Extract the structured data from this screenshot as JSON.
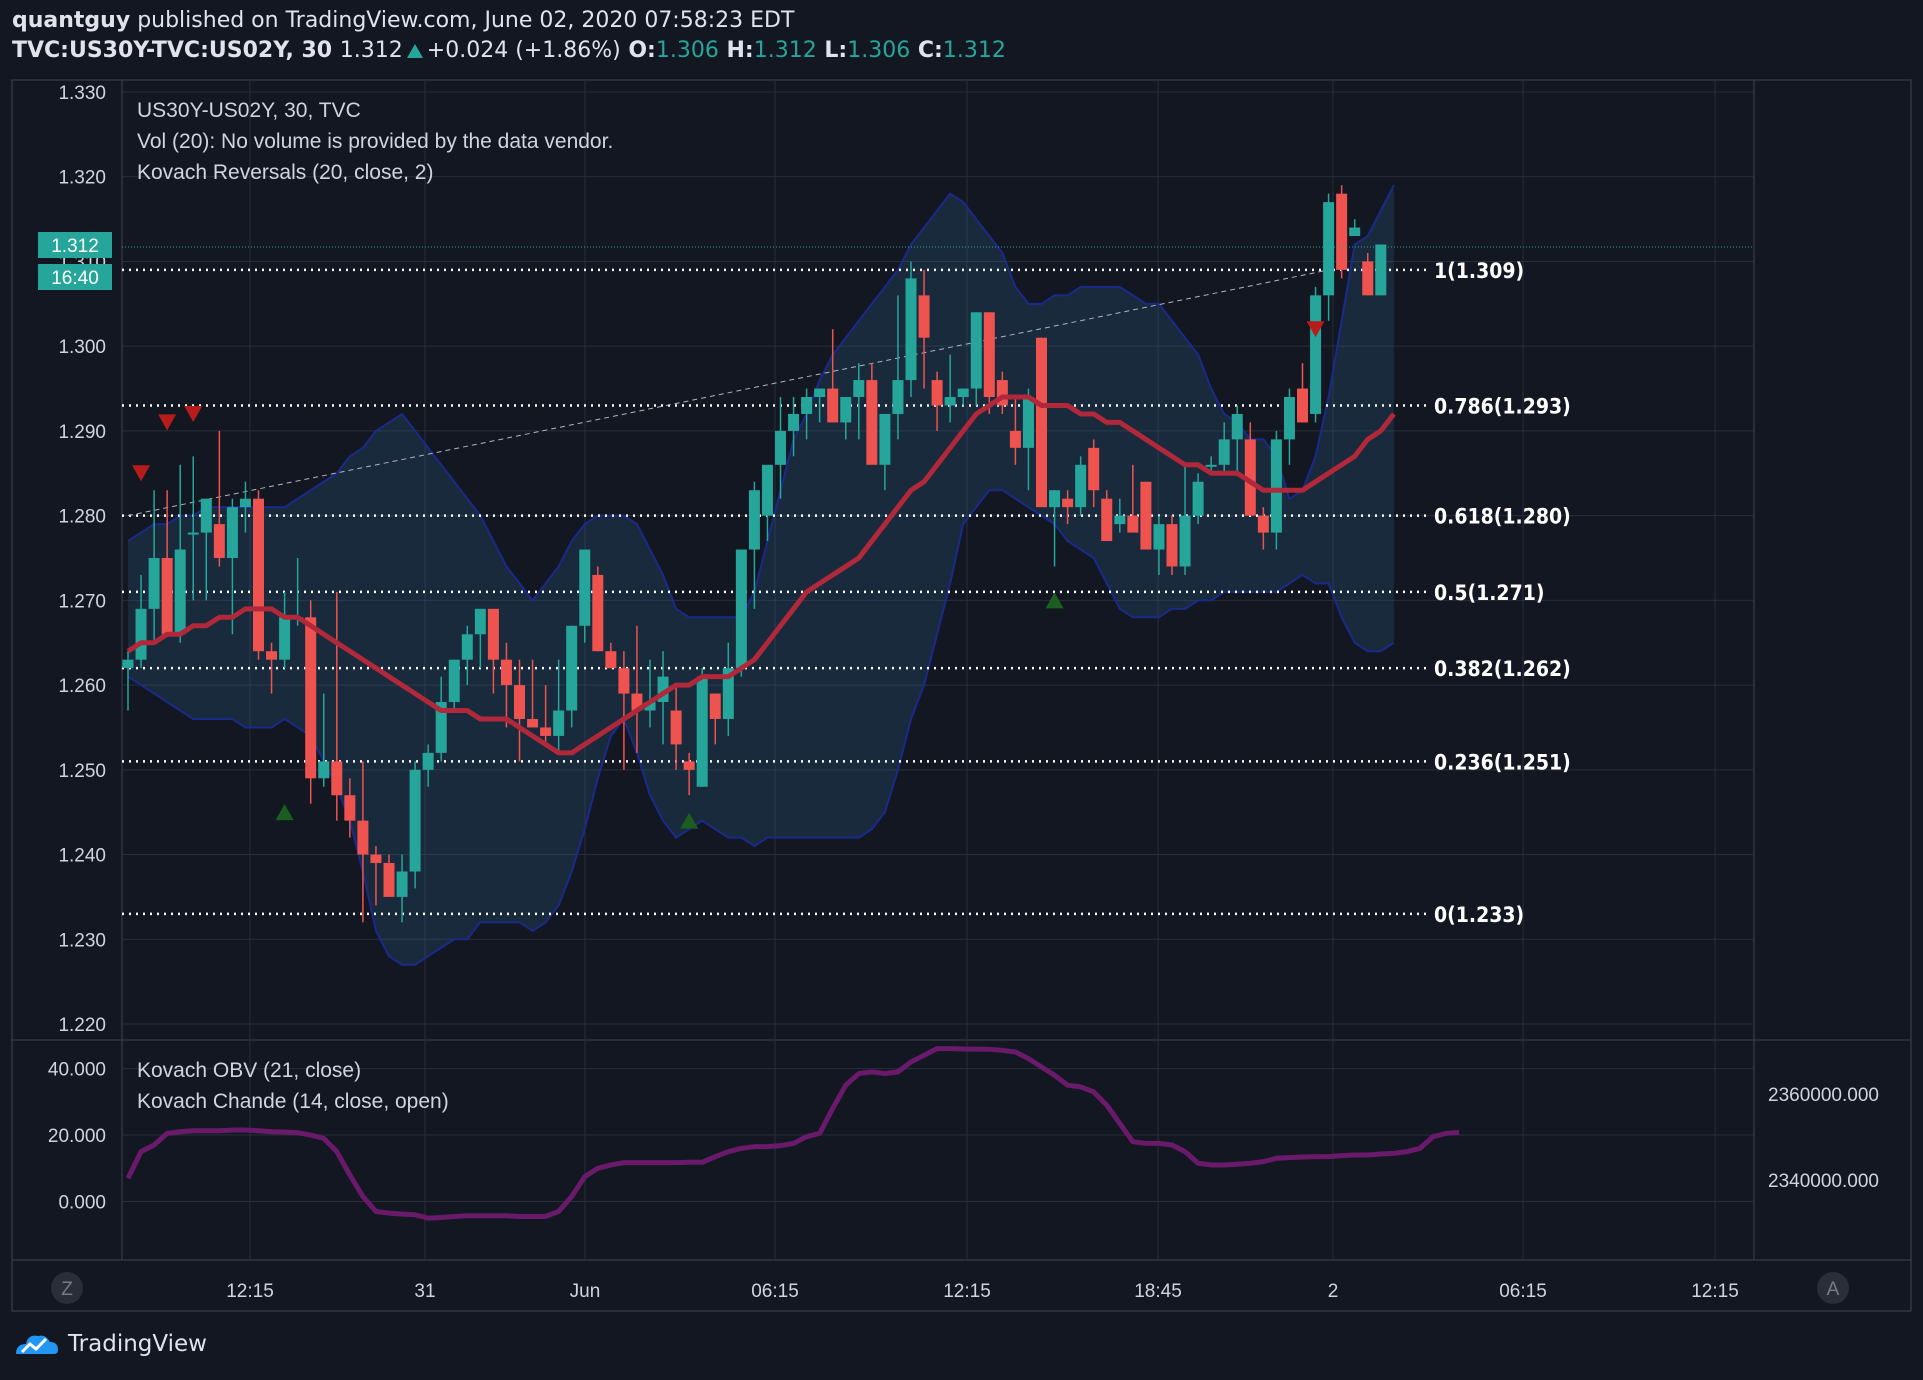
{
  "header": {
    "author": "quantguy",
    "published_text": "published on TradingView.com, June 02, 2020 07:58:23 EDT",
    "symbol": "TVC:US30Y-TVC:US02Y, 30",
    "last": "1.312",
    "change": "+0.024 (+1.86%)",
    "o_label": "O:",
    "o": "1.306",
    "h_label": "H:",
    "h": "1.312",
    "l_label": "L:",
    "l": "1.306",
    "c_label": "C:",
    "c": "1.312"
  },
  "legend": {
    "line1": "US30Y-US02Y, 30, TVC",
    "line2": "Vol (20): No volume is provided by the data vendor.",
    "line3": "Kovach Reversals (20, close, 2)",
    "lower1": "Kovach OBV (21, close)",
    "lower2": "Kovach Chande (14, close, open)"
  },
  "price_tag": {
    "price": "1.312",
    "countdown": "16:40"
  },
  "buttons": {
    "z": "Z",
    "a": "A"
  },
  "footer": {
    "brand": "TradingView"
  },
  "colors": {
    "bg": "#131722",
    "up": "#26a69a",
    "down": "#ef5350",
    "ma": "#b0283a",
    "band": "#1a2a8a",
    "obv": "#6a1a6a"
  },
  "chart_data": [
    {
      "type": "candlestick",
      "title": "US30Y-US02Y, 30, TVC",
      "ylim": [
        1.22,
        1.33
      ],
      "y_ticks": [
        "1.330",
        "1.320",
        "1.310",
        "1.300",
        "1.290",
        "1.280",
        "1.270",
        "1.260",
        "1.250",
        "1.240",
        "1.230",
        "1.220"
      ],
      "x_ticks": [
        "12:15",
        "31",
        "Jun",
        "06:15",
        "12:15",
        "18:45",
        "2",
        "06:15",
        "12:15"
      ],
      "candles": [
        [
          1.262,
          1.264,
          1.257,
          1.263
        ],
        [
          1.263,
          1.273,
          1.262,
          1.269
        ],
        [
          1.269,
          1.283,
          1.265,
          1.275
        ],
        [
          1.275,
          1.283,
          1.266,
          1.266
        ],
        [
          1.266,
          1.286,
          1.265,
          1.276
        ],
        [
          1.278,
          1.287,
          1.27,
          1.278
        ],
        [
          1.278,
          1.282,
          1.27,
          1.282
        ],
        [
          1.279,
          1.29,
          1.274,
          1.275
        ],
        [
          1.275,
          1.282,
          1.266,
          1.281
        ],
        [
          1.281,
          1.284,
          1.278,
          1.282
        ],
        [
          1.282,
          1.283,
          1.263,
          1.264
        ],
        [
          1.264,
          1.265,
          1.259,
          1.263
        ],
        [
          1.263,
          1.271,
          1.262,
          1.268
        ],
        [
          1.268,
          1.275,
          1.267,
          1.268
        ],
        [
          1.268,
          1.27,
          1.246,
          1.249
        ],
        [
          1.249,
          1.259,
          1.248,
          1.251
        ],
        [
          1.251,
          1.271,
          1.244,
          1.247
        ],
        [
          1.247,
          1.249,
          1.242,
          1.244
        ],
        [
          1.244,
          1.251,
          1.232,
          1.24
        ],
        [
          1.24,
          1.241,
          1.234,
          1.239
        ],
        [
          1.239,
          1.24,
          1.235,
          1.235
        ],
        [
          1.235,
          1.24,
          1.232,
          1.238
        ],
        [
          1.238,
          1.251,
          1.236,
          1.25
        ],
        [
          1.25,
          1.253,
          1.248,
          1.252
        ],
        [
          1.252,
          1.261,
          1.251,
          1.258
        ],
        [
          1.258,
          1.263,
          1.257,
          1.263
        ],
        [
          1.263,
          1.267,
          1.26,
          1.266
        ],
        [
          1.266,
          1.267,
          1.262,
          1.269
        ],
        [
          1.269,
          1.269,
          1.259,
          1.263
        ],
        [
          1.263,
          1.265,
          1.255,
          1.26
        ],
        [
          1.26,
          1.263,
          1.251,
          1.256
        ],
        [
          1.256,
          1.263,
          1.255,
          1.255
        ],
        [
          1.255,
          1.26,
          1.253,
          1.254
        ],
        [
          1.254,
          1.263,
          1.252,
          1.257
        ],
        [
          1.257,
          1.267,
          1.255,
          1.267
        ],
        [
          1.267,
          1.276,
          1.265,
          1.276
        ],
        [
          1.273,
          1.274,
          1.264,
          1.264
        ],
        [
          1.264,
          1.265,
          1.262,
          1.262
        ],
        [
          1.262,
          1.264,
          1.25,
          1.259
        ],
        [
          1.259,
          1.267,
          1.252,
          1.257
        ],
        [
          1.257,
          1.263,
          1.255,
          1.258
        ],
        [
          1.258,
          1.264,
          1.253,
          1.261
        ],
        [
          1.257,
          1.26,
          1.25,
          1.253
        ],
        [
          1.251,
          1.252,
          1.247,
          1.25
        ],
        [
          1.248,
          1.262,
          1.248,
          1.261
        ],
        [
          1.259,
          1.259,
          1.253,
          1.256
        ],
        [
          1.256,
          1.265,
          1.254,
          1.262
        ],
        [
          1.262,
          1.276,
          1.261,
          1.276
        ],
        [
          1.276,
          1.284,
          1.269,
          1.283
        ],
        [
          1.28,
          1.285,
          1.277,
          1.286
        ],
        [
          1.286,
          1.294,
          1.282,
          1.29
        ],
        [
          1.29,
          1.294,
          1.287,
          1.292
        ],
        [
          1.292,
          1.295,
          1.289,
          1.294
        ],
        [
          1.294,
          1.295,
          1.291,
          1.295
        ],
        [
          1.295,
          1.302,
          1.291,
          1.291
        ],
        [
          1.291,
          1.294,
          1.289,
          1.294
        ],
        [
          1.294,
          1.298,
          1.289,
          1.296
        ],
        [
          1.296,
          1.298,
          1.287,
          1.286
        ],
        [
          1.286,
          1.292,
          1.283,
          1.292
        ],
        [
          1.292,
          1.306,
          1.289,
          1.296
        ],
        [
          1.296,
          1.31,
          1.294,
          1.308
        ],
        [
          1.306,
          1.309,
          1.295,
          1.301
        ],
        [
          1.296,
          1.297,
          1.29,
          1.293
        ],
        [
          1.293,
          1.299,
          1.291,
          1.294
        ],
        [
          1.294,
          1.295,
          1.293,
          1.295
        ],
        [
          1.295,
          1.304,
          1.293,
          1.304
        ],
        [
          1.304,
          1.304,
          1.292,
          1.294
        ],
        [
          1.296,
          1.297,
          1.292,
          1.293
        ],
        [
          1.29,
          1.294,
          1.286,
          1.288
        ],
        [
          1.288,
          1.295,
          1.283,
          1.294
        ],
        [
          1.301,
          1.301,
          1.281,
          1.281
        ],
        [
          1.281,
          1.283,
          1.274,
          1.283
        ],
        [
          1.282,
          1.283,
          1.279,
          1.281
        ],
        [
          1.281,
          1.287,
          1.28,
          1.286
        ],
        [
          1.288,
          1.289,
          1.281,
          1.283
        ],
        [
          1.282,
          1.283,
          1.277,
          1.277
        ],
        [
          1.279,
          1.282,
          1.278,
          1.28
        ],
        [
          1.28,
          1.286,
          1.278,
          1.278
        ],
        [
          1.284,
          1.284,
          1.276,
          1.276
        ],
        [
          1.276,
          1.28,
          1.273,
          1.279
        ],
        [
          1.279,
          1.28,
          1.273,
          1.274
        ],
        [
          1.274,
          1.286,
          1.273,
          1.28
        ],
        [
          1.28,
          1.285,
          1.279,
          1.284
        ],
        [
          1.286,
          1.287,
          1.285,
          1.286
        ],
        [
          1.286,
          1.291,
          1.285,
          1.289
        ],
        [
          1.289,
          1.293,
          1.285,
          1.292
        ],
        [
          1.289,
          1.291,
          1.28,
          1.28
        ],
        [
          1.28,
          1.281,
          1.276,
          1.278
        ],
        [
          1.278,
          1.29,
          1.276,
          1.289
        ],
        [
          1.289,
          1.295,
          1.286,
          1.294
        ],
        [
          1.295,
          1.298,
          1.291,
          1.291
        ],
        [
          1.292,
          1.307,
          1.291,
          1.306
        ],
        [
          1.306,
          1.318,
          1.303,
          1.317
        ],
        [
          1.318,
          1.319,
          1.308,
          1.309
        ],
        [
          1.313,
          1.315,
          1.313,
          1.314
        ],
        [
          1.31,
          1.311,
          1.306,
          1.306
        ],
        [
          1.306,
          1.312,
          1.306,
          1.312
        ]
      ],
      "moving_average": [
        1.264,
        1.265,
        1.265,
        1.266,
        1.266,
        1.267,
        1.267,
        1.268,
        1.268,
        1.269,
        1.269,
        1.269,
        1.268,
        1.268,
        1.267,
        1.266,
        1.265,
        1.264,
        1.263,
        1.262,
        1.261,
        1.26,
        1.259,
        1.258,
        1.257,
        1.257,
        1.257,
        1.256,
        1.256,
        1.256,
        1.255,
        1.254,
        1.253,
        1.252,
        1.252,
        1.253,
        1.254,
        1.255,
        1.256,
        1.257,
        1.258,
        1.259,
        1.26,
        1.26,
        1.261,
        1.261,
        1.261,
        1.262,
        1.263,
        1.265,
        1.267,
        1.269,
        1.271,
        1.272,
        1.273,
        1.274,
        1.275,
        1.277,
        1.279,
        1.281,
        1.283,
        1.284,
        1.286,
        1.288,
        1.29,
        1.292,
        1.293,
        1.294,
        1.294,
        1.294,
        1.293,
        1.293,
        1.293,
        1.292,
        1.292,
        1.291,
        1.291,
        1.29,
        1.289,
        1.288,
        1.287,
        1.286,
        1.286,
        1.285,
        1.285,
        1.285,
        1.284,
        1.283,
        1.283,
        1.283,
        1.283,
        1.284,
        1.285,
        1.286,
        1.287,
        1.289,
        1.29,
        1.292
      ],
      "upper_band": [
        1.277,
        1.278,
        1.279,
        1.279,
        1.28,
        1.28,
        1.281,
        1.281,
        1.281,
        1.281,
        1.281,
        1.281,
        1.281,
        1.282,
        1.283,
        1.284,
        1.285,
        1.287,
        1.288,
        1.29,
        1.291,
        1.292,
        1.29,
        1.288,
        1.286,
        1.284,
        1.282,
        1.28,
        1.277,
        1.274,
        1.272,
        1.27,
        1.272,
        1.274,
        1.277,
        1.279,
        1.28,
        1.28,
        1.28,
        1.279,
        1.276,
        1.273,
        1.269,
        1.268,
        1.268,
        1.268,
        1.268,
        1.268,
        1.271,
        1.277,
        1.283,
        1.289,
        1.292,
        1.296,
        1.299,
        1.301,
        1.303,
        1.305,
        1.307,
        1.309,
        1.312,
        1.314,
        1.316,
        1.318,
        1.317,
        1.315,
        1.313,
        1.311,
        1.307,
        1.305,
        1.305,
        1.306,
        1.306,
        1.307,
        1.307,
        1.307,
        1.307,
        1.306,
        1.305,
        1.305,
        1.303,
        1.301,
        1.299,
        1.295,
        1.292,
        1.291,
        1.289,
        1.289,
        1.287,
        1.282,
        1.283,
        1.287,
        1.294,
        1.303,
        1.312,
        1.313,
        1.316,
        1.319
      ],
      "lower_band": [
        1.261,
        1.26,
        1.259,
        1.258,
        1.257,
        1.256,
        1.256,
        1.256,
        1.256,
        1.255,
        1.255,
        1.255,
        1.256,
        1.255,
        1.254,
        1.251,
        1.248,
        1.244,
        1.238,
        1.231,
        1.228,
        1.227,
        1.227,
        1.228,
        1.229,
        1.23,
        1.23,
        1.232,
        1.232,
        1.232,
        1.232,
        1.231,
        1.232,
        1.234,
        1.238,
        1.243,
        1.249,
        1.254,
        1.256,
        1.252,
        1.247,
        1.244,
        1.242,
        1.243,
        1.244,
        1.243,
        1.242,
        1.242,
        1.241,
        1.242,
        1.242,
        1.242,
        1.242,
        1.242,
        1.242,
        1.242,
        1.242,
        1.243,
        1.245,
        1.25,
        1.256,
        1.26,
        1.266,
        1.272,
        1.279,
        1.281,
        1.283,
        1.283,
        1.282,
        1.281,
        1.28,
        1.279,
        1.277,
        1.276,
        1.275,
        1.272,
        1.269,
        1.268,
        1.268,
        1.268,
        1.269,
        1.269,
        1.27,
        1.27,
        1.271,
        1.271,
        1.271,
        1.271,
        1.271,
        1.272,
        1.273,
        1.272,
        1.272,
        1.268,
        1.265,
        1.264,
        1.264,
        1.265
      ],
      "reversal_markers": [
        {
          "index": 1,
          "dir": "down",
          "price": 1.285
        },
        {
          "index": 3,
          "dir": "down",
          "price": 1.291
        },
        {
          "index": 5,
          "dir": "down",
          "price": 1.292
        },
        {
          "index": 12,
          "dir": "up",
          "price": 1.245
        },
        {
          "index": 43,
          "dir": "up",
          "price": 1.244
        },
        {
          "index": 71,
          "dir": "up",
          "price": 1.27
        },
        {
          "index": 91,
          "dir": "down",
          "price": 1.302
        }
      ],
      "fib_levels": [
        {
          "label": "1(1.309)",
          "price": 1.309
        },
        {
          "label": "0.786(1.293)",
          "price": 1.293
        },
        {
          "label": "0.618(1.280)",
          "price": 1.28
        },
        {
          "label": "0.5(1.271)",
          "price": 1.271
        },
        {
          "label": "0.382(1.262)",
          "price": 1.262
        },
        {
          "label": "0.236(1.251)",
          "price": 1.251
        },
        {
          "label": "0(1.233)",
          "price": 1.233
        }
      ],
      "trend_line": [
        [
          0,
          1.28
        ],
        [
          92,
          1.309
        ]
      ],
      "last_price": 1.312
    },
    {
      "type": "line",
      "title": "Kovach OBV (21, close)",
      "ylim": [
        -17,
        48
      ],
      "y_ticks_left": [
        "40.000",
        "20.000",
        "0.000"
      ],
      "y_ticks_right": [
        "2360000.000",
        "2340000.000"
      ],
      "series": [
        {
          "name": "Kovach Chande (14, close, open)",
          "values": [
            7,
            15,
            17,
            20.5,
            21,
            21.3,
            21.3,
            21.3,
            21.5,
            21.5,
            21.3,
            21,
            20.9,
            20.7,
            20,
            19,
            15,
            8,
            1.5,
            -3,
            -3.5,
            -3.8,
            -4,
            -5,
            -4.8,
            -4.5,
            -4.3,
            -4.3,
            -4.3,
            -4.3,
            -4.5,
            -4.5,
            -4.5,
            -3,
            1.5,
            7.5,
            10,
            11,
            11.7,
            11.7,
            11.7,
            11.7,
            11.7,
            11.8,
            11.8,
            13.5,
            15,
            16,
            16.5,
            16.5,
            16.8,
            17.5,
            19.5,
            20.5,
            28,
            35,
            38.5,
            39,
            38.5,
            39,
            42,
            44,
            46,
            46,
            45.9,
            45.8,
            45.8,
            45.5,
            45,
            43,
            40.5,
            38,
            35,
            34.5,
            33,
            29,
            23.5,
            18,
            17.5,
            17.5,
            17,
            15,
            11.5,
            11,
            11,
            11.2,
            11.5,
            12,
            13,
            13.2,
            13.4,
            13.5,
            13.5,
            13.8,
            14,
            14,
            14.3,
            14.5,
            15,
            16,
            19.5,
            20.5,
            20.8
          ]
        }
      ]
    }
  ]
}
